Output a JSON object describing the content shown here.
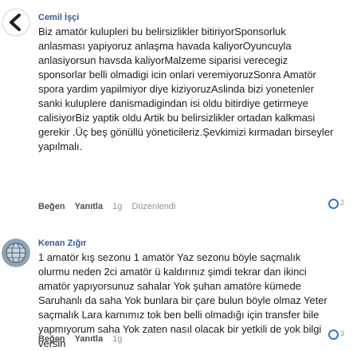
{
  "comments": [
    {
      "author": "Cemil İşçi",
      "text": "Biz amatör kulupleri bu belirsizlikler bitiriyorSponsorluk anlasması yapiyoruz anlaşma havada kaliyorOyuncuyla anlasiyorsun havsda kaliyorMalzeme siparisi verecegiz sponsorlar belli olmadigi icin onlari veremiyoruzSonra Amatör spora yardim yapilmiyor diye kiziyoruzAslinda bizi yonetenler sanki kuluplere danismadigindan isi oldu bitirdiye getirmeye calisiyorBiz yaptik oldu Artik bu belirsizlikler ortadan kalkmasi gerekir .Üç beş gönüllü yöneticileriz.Şevkimizi kırmadan birseyler yapılmalı.",
      "actions": [
        "Beğen",
        "Yanıtla",
        "1g",
        "Düzenlendi"
      ],
      "reaction_count": "2",
      "reaction_icon": "like-reaction-icon",
      "avatar_icon": "back-arrow-icon"
    },
    {
      "author": "Kenan Zığır",
      "text": "1 amatör kış sezonu 1 amatör Yaz sezonu böyle saçmalık olurmu neden 2ci amatör ü kaldırınız şimdi tekrar dan ikinci amatör yapıyorsunuz sahalar Yok şuhan amatöre kümede Saruhanlı da saha Yok bunlara bir çare bulun böyle olmaz Yeter saçmalık Lara karnımız tok ben belli olmadığı için transfer bile yapmıyorum saha Yok zaten nasıl olacak bir yetkili de yok bilgi versin",
      "actions": [
        "Beğen",
        "Yanıtla",
        "1g"
      ],
      "reaction_count": "3",
      "reaction_icon": "like-reaction-icon",
      "avatar_icon": "globe-icon"
    }
  ],
  "colors": {
    "author": "#365899",
    "action": "#4b4f56",
    "muted": "#90949c",
    "reaction": "#2e7bc6"
  }
}
